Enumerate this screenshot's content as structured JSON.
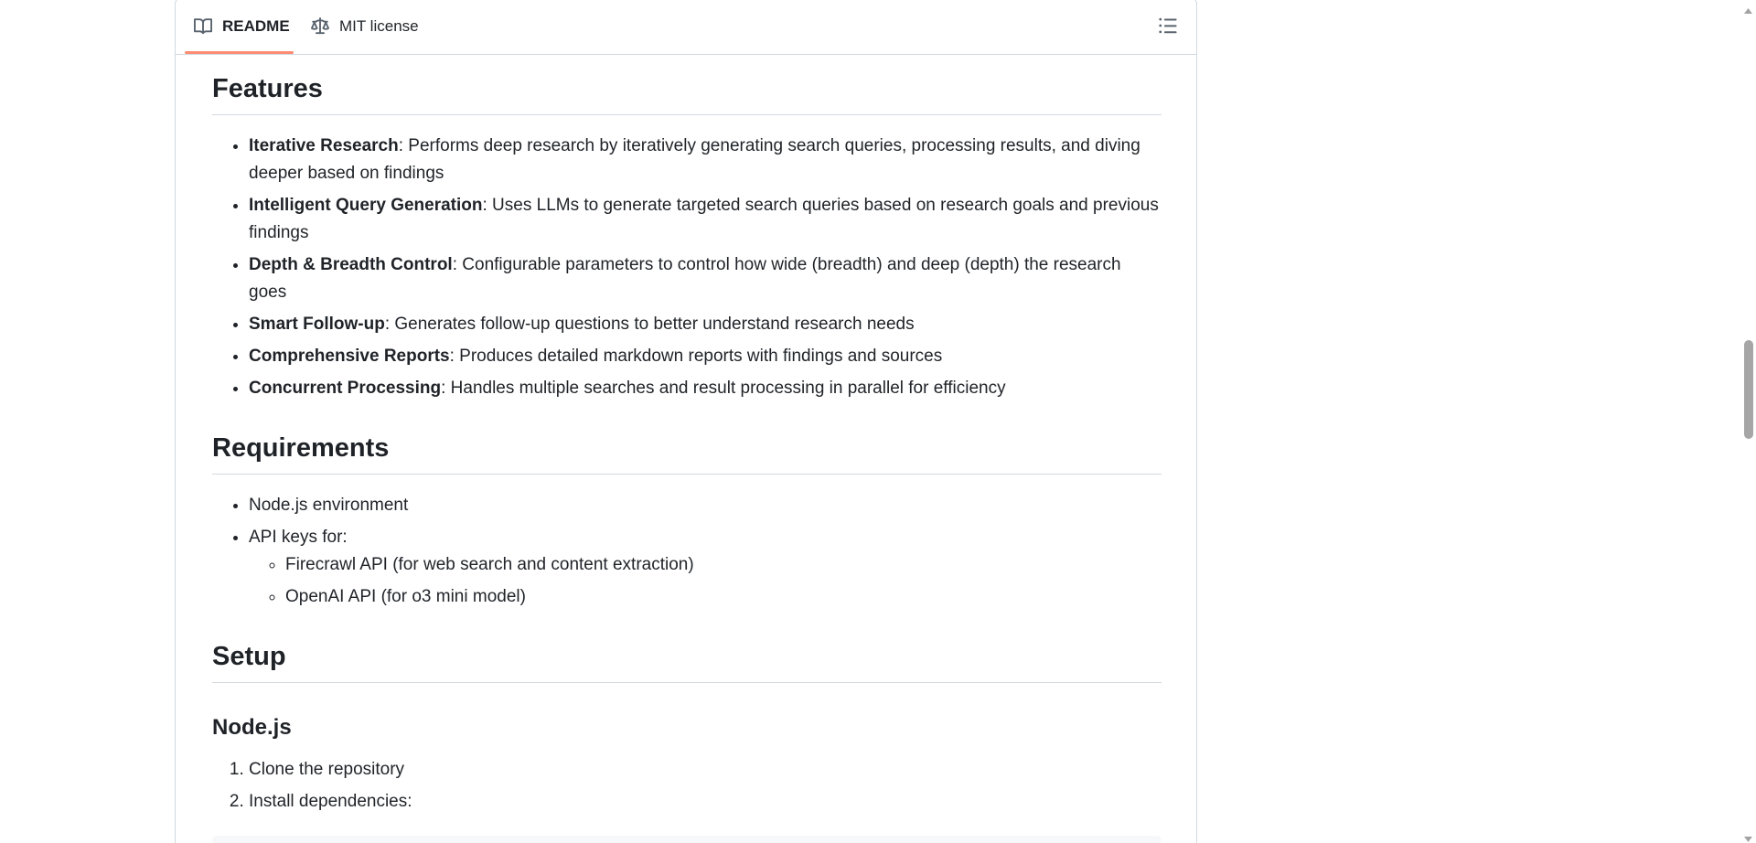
{
  "tabs": {
    "readme_label": "README",
    "license_label": "MIT license"
  },
  "sections": {
    "features": {
      "title": "Features",
      "items": [
        {
          "term": "Iterative Research",
          "desc": ": Performs deep research by iteratively generating search queries, processing results, and diving deeper based on findings"
        },
        {
          "term": "Intelligent Query Generation",
          "desc": ": Uses LLMs to generate targeted search queries based on research goals and previous findings"
        },
        {
          "term": "Depth & Breadth Control",
          "desc": ": Configurable parameters to control how wide (breadth) and deep (depth) the research goes"
        },
        {
          "term": "Smart Follow-up",
          "desc": ": Generates follow-up questions to better understand research needs"
        },
        {
          "term": "Comprehensive Reports",
          "desc": ": Produces detailed markdown reports with findings and sources"
        },
        {
          "term": "Concurrent Processing",
          "desc": ": Handles multiple searches and result processing in parallel for efficiency"
        }
      ]
    },
    "requirements": {
      "title": "Requirements",
      "items": [
        "Node.js environment",
        "API keys for:"
      ],
      "subitems": [
        "Firecrawl API (for web search and content extraction)",
        "OpenAI API (for o3 mini model)"
      ]
    },
    "setup": {
      "title": "Setup",
      "subtitle": "Node.js",
      "steps": [
        "Clone the repository",
        "Install dependencies:"
      ]
    }
  },
  "colors": {
    "accent_underline": "#fd8c73",
    "border": "#d1d9e0",
    "text": "#1f2328"
  },
  "icons": {
    "readme_tab": "book-icon",
    "license_tab": "scale-icon",
    "toc": "list-unordered-icon"
  }
}
